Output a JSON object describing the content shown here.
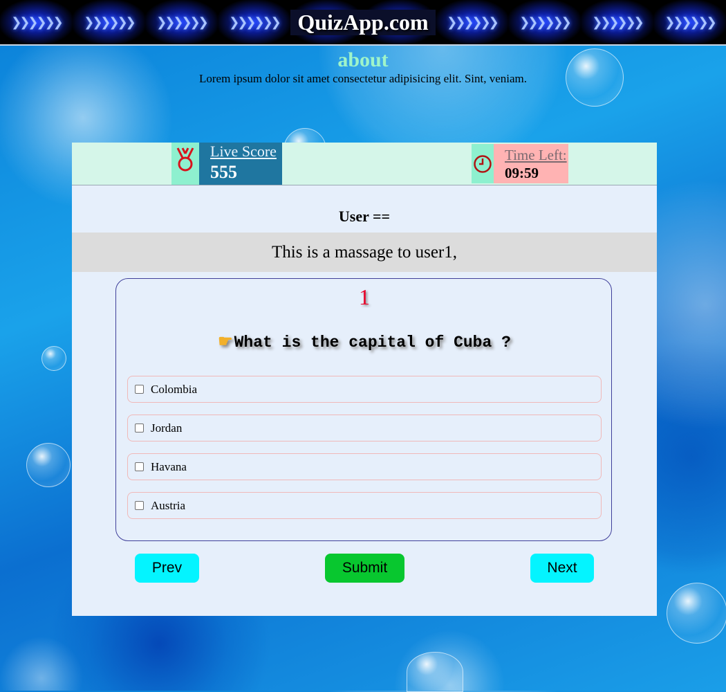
{
  "header": {
    "brand": "QuizApp.com",
    "arrow_tiles": 10,
    "arrow_glyph": "❯❯❯❯❯❯"
  },
  "about": {
    "title": "about",
    "text": "Lorem ipsum dolor sit amet consectetur adipisicing elit. Sint, veniam."
  },
  "score": {
    "label": "Live Score",
    "value": "555",
    "icon": "medal-icon"
  },
  "timer": {
    "label": "Time Left:",
    "value": "09:59",
    "icon": "clock-icon"
  },
  "user": {
    "line": "User =="
  },
  "message": {
    "text": "This is a massage to user1,"
  },
  "question": {
    "number": "1",
    "pointer_icon": "hand-pointing-icon",
    "text": "What is the capital of Cuba ?",
    "options": [
      {
        "label": "Colombia",
        "checked": false
      },
      {
        "label": "Jordan",
        "checked": false
      },
      {
        "label": "Havana",
        "checked": false
      },
      {
        "label": "Austria",
        "checked": false
      }
    ]
  },
  "buttons": {
    "prev": "Prev",
    "submit": "Submit",
    "next": "Next"
  },
  "colors": {
    "brand_text": "#ffffff",
    "about_title": "#9ff4c9",
    "question_number": "#e8002a",
    "prev_next_button": "#04f4ff",
    "submit_button": "#08c72f",
    "score_box": "#1f76a0",
    "time_box": "#ffb3b3"
  }
}
